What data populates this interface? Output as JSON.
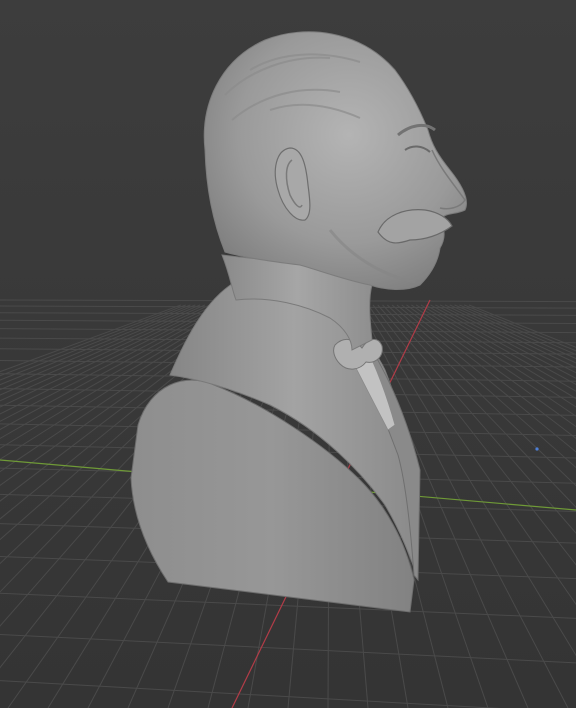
{
  "viewport": {
    "background_color": "#3b3b3b",
    "grid_color": "#4a4a4a",
    "x_axis_color": "#c0404f",
    "y_axis_color": "#7fb33a",
    "model_color": "#9e9e9e",
    "model_shadow_color": "#6c6c6c",
    "model_highlight_color": "#c9c9c9"
  },
  "scene": {
    "object": "bust-sculpt-model",
    "axis_gizmo_dot_color": "#4d7fd6"
  }
}
